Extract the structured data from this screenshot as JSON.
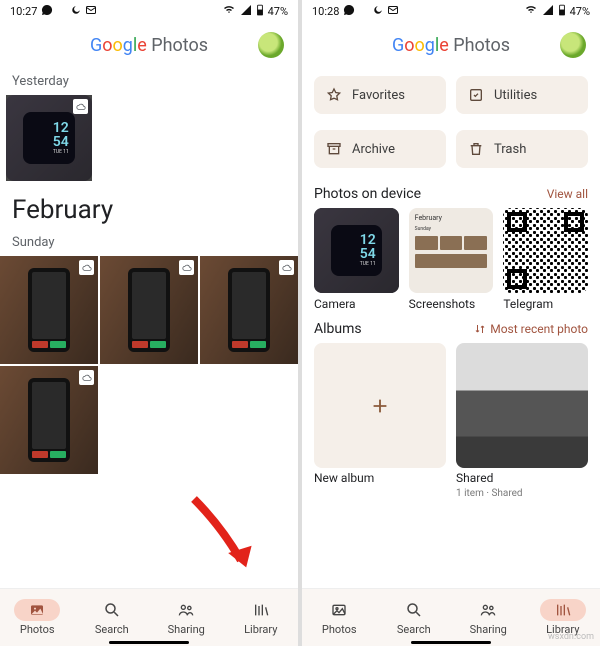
{
  "left": {
    "status": {
      "time": "10:27",
      "battery": "47%"
    },
    "logo_grey": "Photos",
    "yesterday_label": "Yesterday",
    "month": "February",
    "sunday_label": "Sunday",
    "watch": {
      "l1": "12",
      "l2": "54",
      "l3": "TUE 11"
    },
    "nav": {
      "photos": "Photos",
      "search": "Search",
      "sharing": "Sharing",
      "library": "Library"
    }
  },
  "right": {
    "status": {
      "time": "10:28",
      "battery": "47%"
    },
    "chips": {
      "favorites": "Favorites",
      "utilities": "Utilities",
      "archive": "Archive",
      "trash": "Trash"
    },
    "photos_on_device": "Photos on device",
    "view_all": "View all",
    "device": {
      "camera": "Camera",
      "screenshots": "Screenshots",
      "telegram": "Telegram"
    },
    "ss_inner": {
      "month": "February",
      "day": "Sunday"
    },
    "albums_label": "Albums",
    "sort_label": "Most recent photo",
    "new_album": "New album",
    "shared": {
      "title": "Shared",
      "sub": "1 item · Shared"
    },
    "nav": {
      "photos": "Photos",
      "search": "Search",
      "sharing": "Sharing",
      "library": "Library"
    }
  }
}
